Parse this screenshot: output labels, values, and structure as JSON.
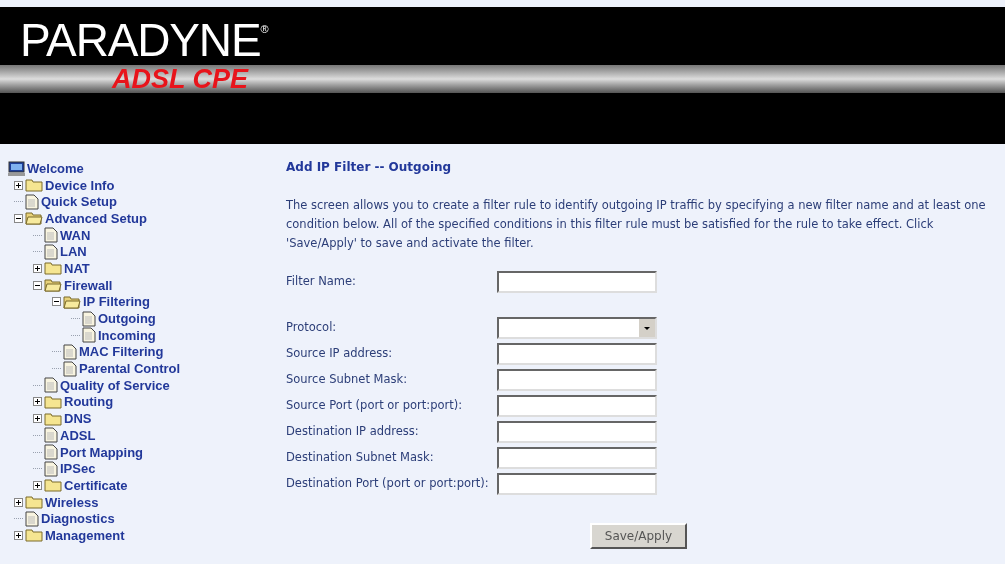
{
  "header": {
    "brand": "PARADYNE",
    "registered": "®",
    "product": "ADSL CPE"
  },
  "sidebar": {
    "items": [
      {
        "label": "Welcome",
        "kind": "computer"
      },
      {
        "label": "Device Info",
        "kind": "folder",
        "expanded": false
      },
      {
        "label": "Quick Setup",
        "kind": "page"
      },
      {
        "label": "Advanced Setup",
        "kind": "folder",
        "expanded": true,
        "children": [
          {
            "label": "WAN",
            "kind": "page"
          },
          {
            "label": "LAN",
            "kind": "page"
          },
          {
            "label": "NAT",
            "kind": "folder",
            "expanded": false
          },
          {
            "label": "Firewall",
            "kind": "folder",
            "expanded": true,
            "children": [
              {
                "label": "IP Filtering",
                "kind": "folder",
                "expanded": true,
                "children": [
                  {
                    "label": "Outgoing",
                    "kind": "page"
                  },
                  {
                    "label": "Incoming",
                    "kind": "page"
                  }
                ]
              },
              {
                "label": "MAC Filtering",
                "kind": "page"
              },
              {
                "label": "Parental Control",
                "kind": "page"
              }
            ]
          },
          {
            "label": "Quality of Service",
            "kind": "page"
          },
          {
            "label": "Routing",
            "kind": "folder",
            "expanded": false
          },
          {
            "label": "DNS",
            "kind": "folder",
            "expanded": false
          },
          {
            "label": "ADSL",
            "kind": "page"
          },
          {
            "label": "Port Mapping",
            "kind": "page"
          },
          {
            "label": "IPSec",
            "kind": "page"
          },
          {
            "label": "Certificate",
            "kind": "folder",
            "expanded": false
          }
        ]
      },
      {
        "label": "Wireless",
        "kind": "folder",
        "expanded": false
      },
      {
        "label": "Diagnostics",
        "kind": "page"
      },
      {
        "label": "Management",
        "kind": "folder",
        "expanded": false
      }
    ]
  },
  "main": {
    "title": "Add IP Filter -- Outgoing",
    "description": "The screen allows you to create a filter rule to identify outgoing IP traffic by specifying a new filter name and at least one condition below. All of the specified conditions in this filter rule must be satisfied for the rule to take effect. Click 'Save/Apply' to save and activate the filter.",
    "fields": [
      {
        "label": "Filter Name:",
        "kind": "text"
      },
      {
        "label": "Protocol:",
        "kind": "select"
      },
      {
        "label": "Source IP address:",
        "kind": "text"
      },
      {
        "label": "Source Subnet Mask:",
        "kind": "text"
      },
      {
        "label": "Source Port (port or port:port):",
        "kind": "text"
      },
      {
        "label": "Destination IP address:",
        "kind": "text"
      },
      {
        "label": "Destination Subnet Mask:",
        "kind": "text"
      },
      {
        "label": "Destination Port (port or port:port):",
        "kind": "text"
      }
    ],
    "button": "Save/Apply"
  }
}
